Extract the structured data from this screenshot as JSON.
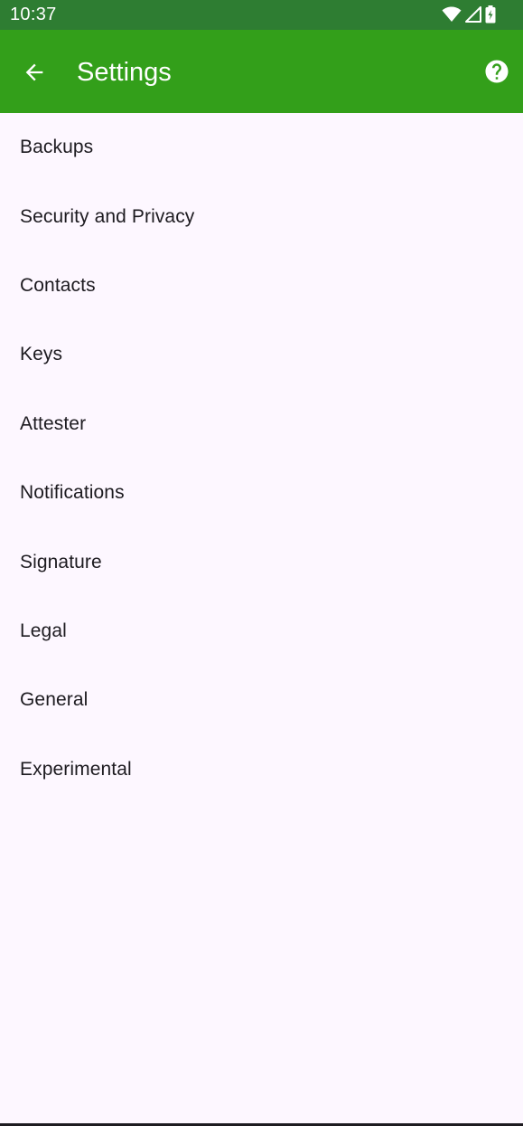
{
  "status_bar": {
    "time": "10:37",
    "icons": [
      "wifi-icon",
      "signal-icon",
      "battery-charging-icon"
    ]
  },
  "app_bar": {
    "title": "Settings",
    "back_icon": "arrow-back-icon",
    "help_icon": "help-circle-icon"
  },
  "settings": {
    "items": [
      {
        "label": "Backups"
      },
      {
        "label": "Security and Privacy"
      },
      {
        "label": "Contacts"
      },
      {
        "label": "Keys"
      },
      {
        "label": "Attester"
      },
      {
        "label": "Notifications"
      },
      {
        "label": "Signature"
      },
      {
        "label": "Legal"
      },
      {
        "label": "General"
      },
      {
        "label": "Experimental"
      }
    ]
  },
  "colors": {
    "status_bar": "#2e7d32",
    "app_bar": "#339f1a",
    "background": "#fdf7ff",
    "text": "#1d1b20"
  }
}
